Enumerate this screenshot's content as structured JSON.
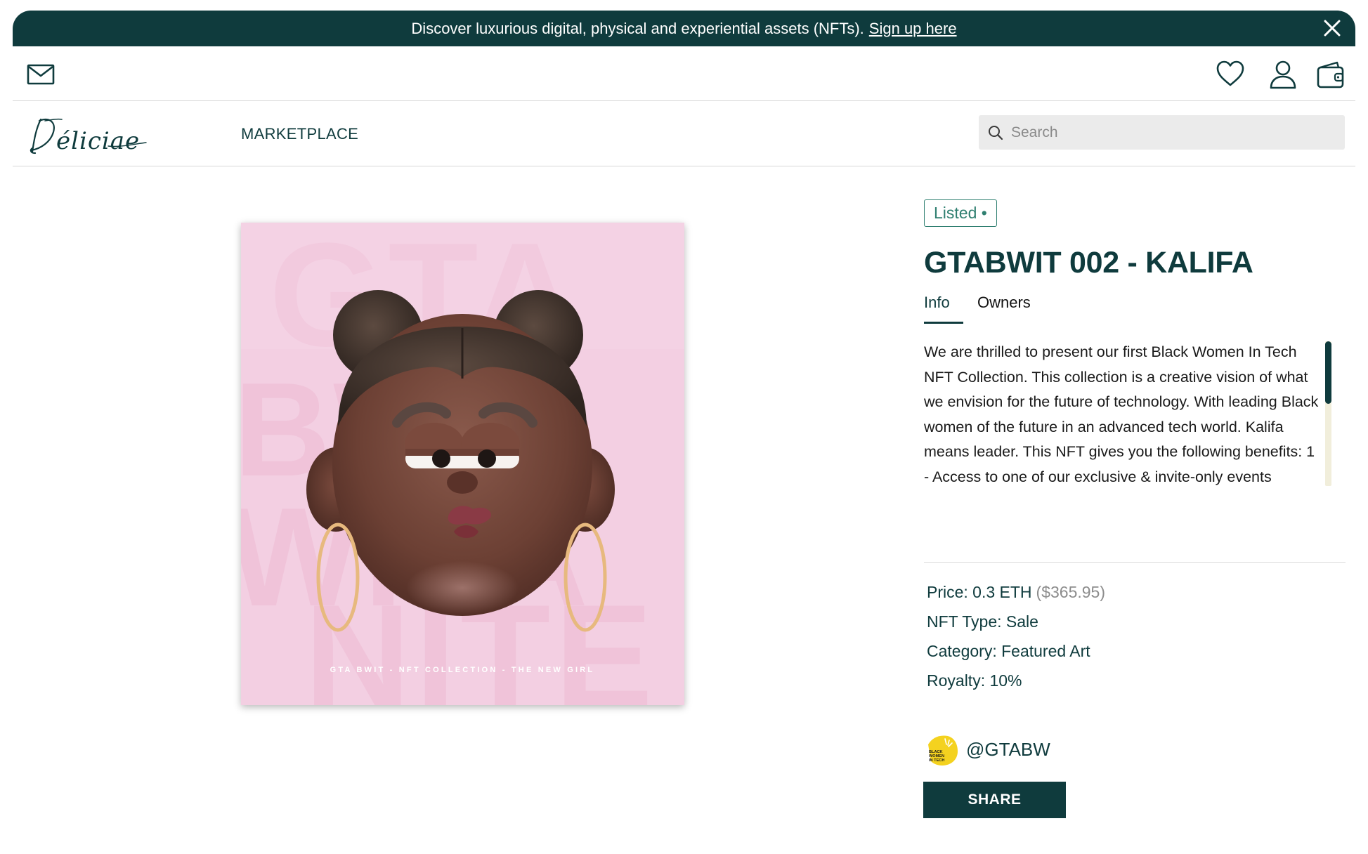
{
  "banner": {
    "text": "Discover luxurious digital, physical and experiential assets (NFTs).",
    "link": "Sign up here"
  },
  "nav": {
    "logo_text": "Déliciae",
    "marketplace": "MARKETPLACE",
    "search_placeholder": "Search"
  },
  "artwork": {
    "caption": "GTA BWIT - NFT COLLECTION - THE NEW GIRL",
    "bg_letters": [
      "GTA",
      "BWIT",
      "NITE"
    ],
    "background_color": "#f3cfe2"
  },
  "item": {
    "status": "Listed •",
    "title": "GTABWIT 002 - KALIFA",
    "tabs": [
      "Info",
      "Owners"
    ],
    "description": "We are thrilled to present our first Black Women In Tech NFT Collection. This collection is a creative vision of what we envision for the future of technology. With leading Black women of the future in an advanced tech world. Kalifa means leader. This NFT gives you the following benefits: 1 - Access to one of our exclusive & invite-only events"
  },
  "properties": {
    "price_label": "Price: 0.3 ETH",
    "price_usd": "($365.95)",
    "type": "NFT Type: Sale",
    "category": "Category: Featured Art",
    "royalty": "Royalty: 10%"
  },
  "creator": {
    "handle": "@GTABW",
    "avatar_text": [
      "BLACK",
      "WOMEN",
      "IN TECH"
    ]
  },
  "share_label": "SHARE",
  "colors": {
    "primary": "#0f3b3d",
    "badge": "#2f7f70",
    "muted": "#8c8c8c",
    "avatar_yellow": "#f4d21f"
  }
}
